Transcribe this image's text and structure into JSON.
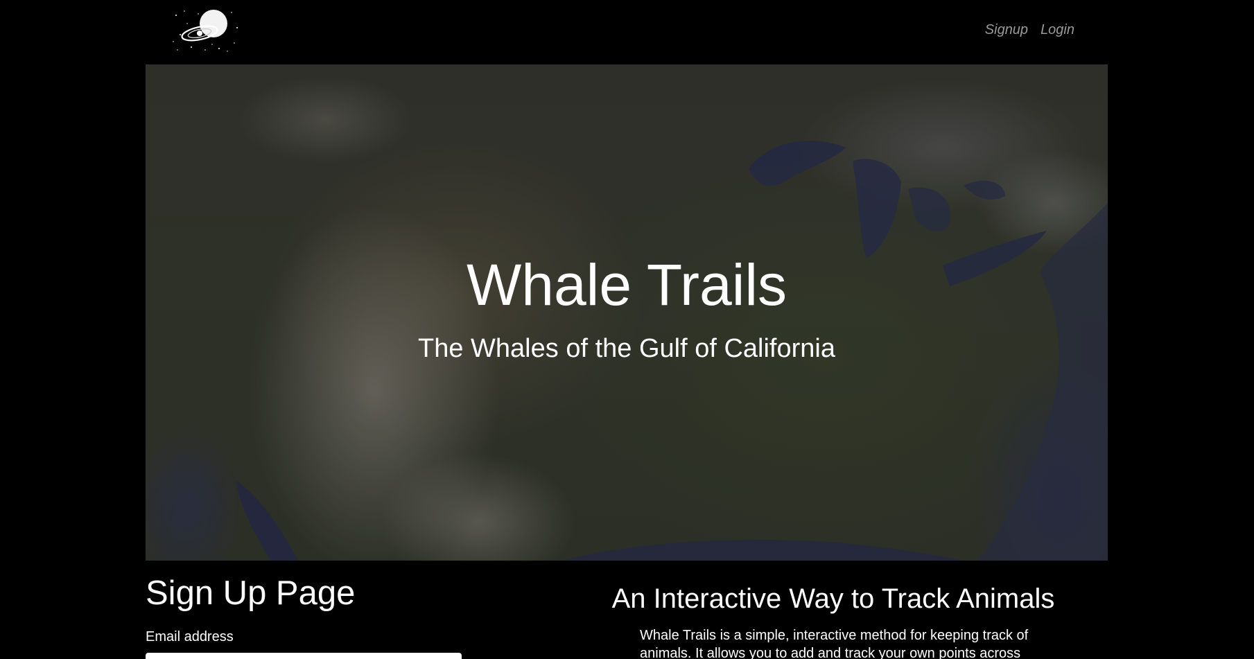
{
  "navbar": {
    "logo_icon": "planet-with-rings-logo",
    "links": [
      {
        "label": "Signup"
      },
      {
        "label": "Login"
      }
    ]
  },
  "hero": {
    "title": "Whale Trails",
    "subtitle": "The Whales of the Gulf of California",
    "background": "satellite-map-north-america"
  },
  "signup": {
    "title": "Sign Up Page",
    "email_label": "Email address",
    "email_value": "",
    "email_placeholder": ""
  },
  "info": {
    "title": "An Interactive Way to Track Animals",
    "text": "Whale Trails is a simple, interactive method for keeping track of animals. It allows you to add and track your own points across the"
  },
  "colors": {
    "background": "#000000",
    "text": "#ffffff",
    "nav_link": "#9a9a9a"
  }
}
